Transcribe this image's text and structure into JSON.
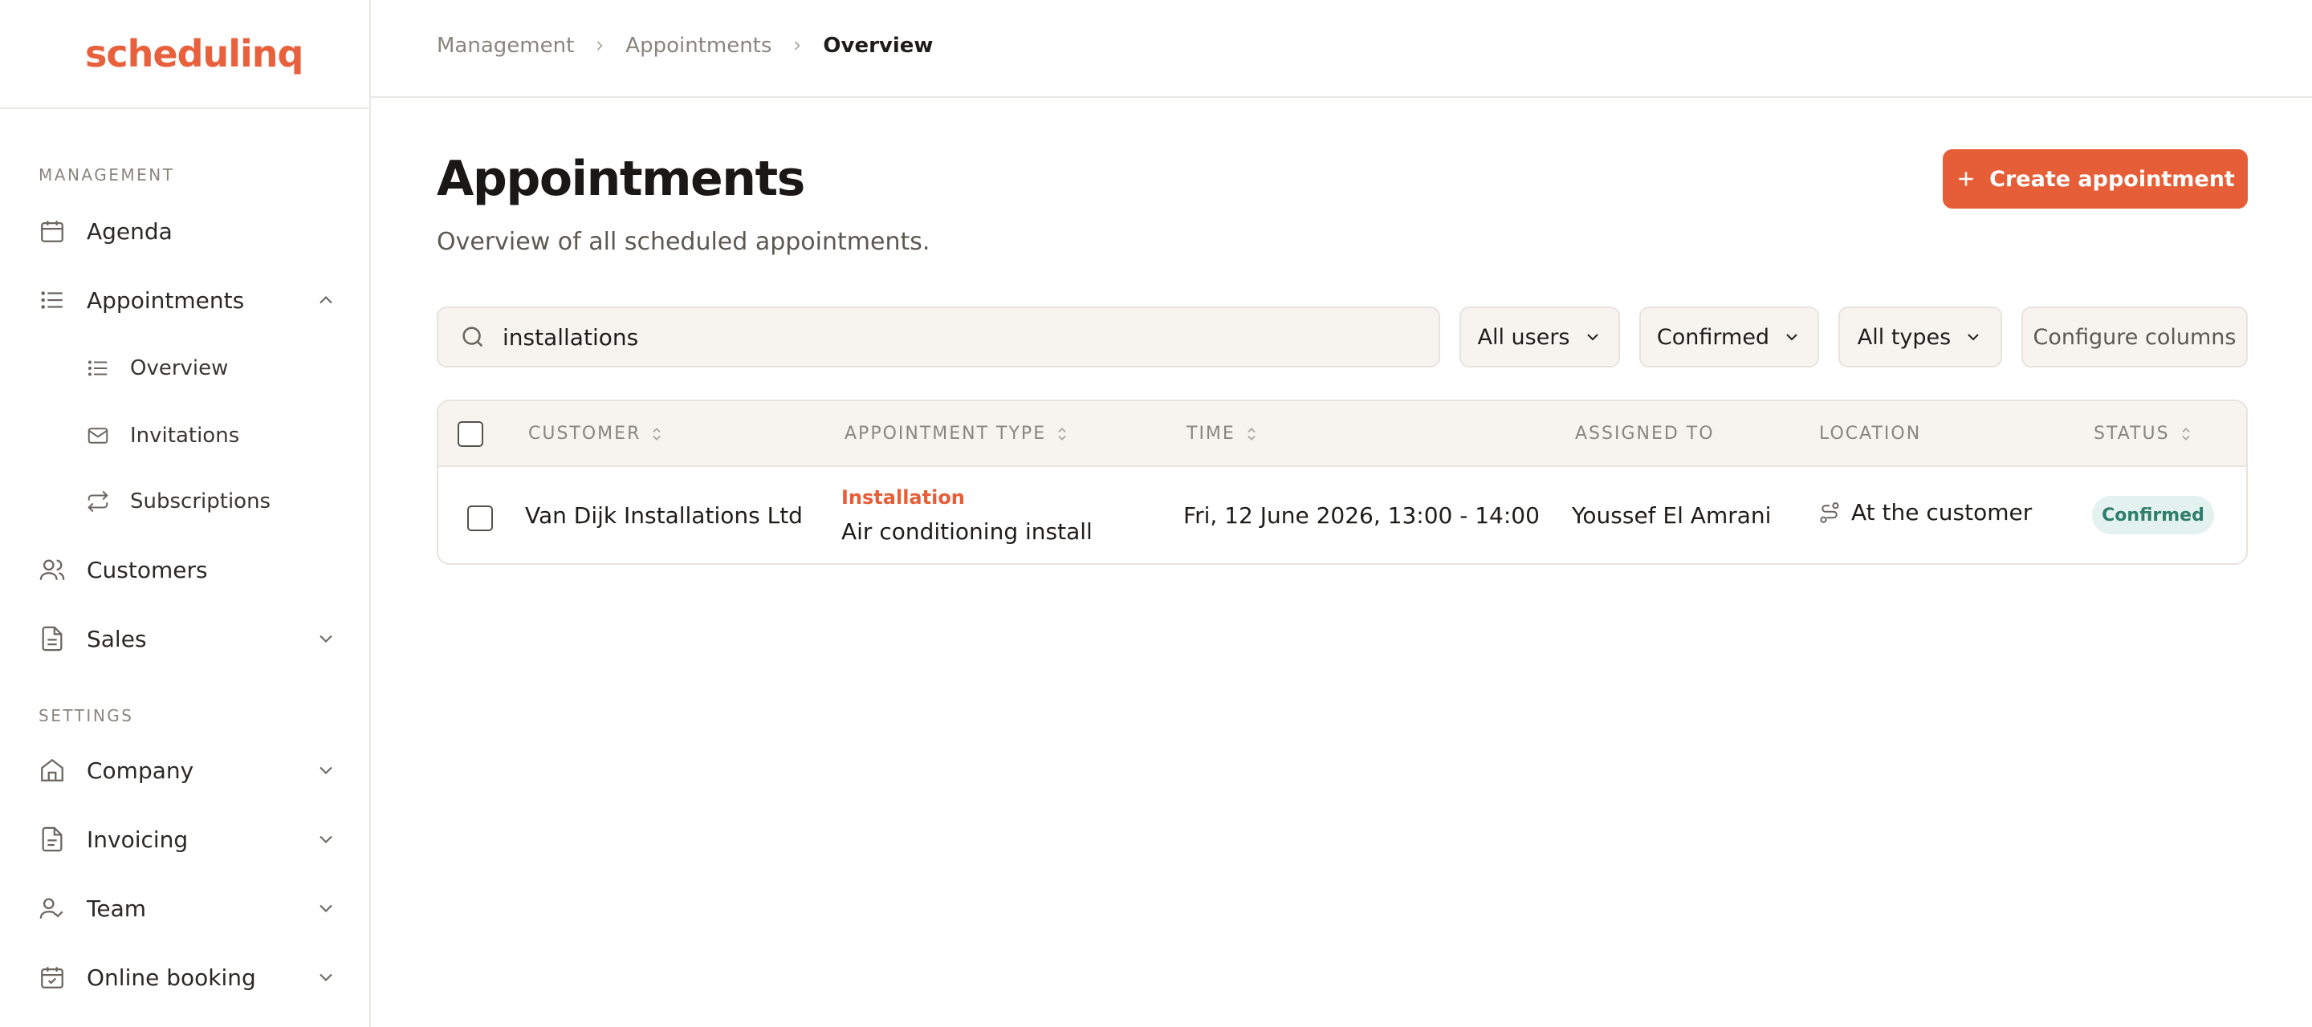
{
  "app": {
    "logo_text": "schedulinq",
    "brand_color": "#e8603c"
  },
  "sidebar": {
    "sections": [
      {
        "title": "MANAGEMENT"
      },
      {
        "title": "SETTINGS"
      }
    ],
    "items": [
      {
        "label": "Agenda",
        "icon": "calendar-icon"
      },
      {
        "label": "Appointments",
        "icon": "list-icon",
        "expanded": true
      },
      {
        "label": "Customers",
        "icon": "users-icon"
      },
      {
        "label": "Sales",
        "icon": "document-icon"
      },
      {
        "label": "Company",
        "icon": "building-icon"
      },
      {
        "label": "Invoicing",
        "icon": "invoice-icon"
      },
      {
        "label": "Team",
        "icon": "team-icon"
      },
      {
        "label": "Online booking",
        "icon": "calendar-check-icon"
      }
    ],
    "subitems": [
      {
        "label": "Overview",
        "icon": "list-icon"
      },
      {
        "label": "Invitations",
        "icon": "mail-icon"
      },
      {
        "label": "Subscriptions",
        "icon": "repeat-icon"
      }
    ]
  },
  "breadcrumb": [
    "Management",
    "Appointments",
    "Overview"
  ],
  "page": {
    "title": "Appointments",
    "subtitle": "Overview of all scheduled appointments.",
    "create_button": "Create appointment"
  },
  "filters": {
    "search_value": "installations",
    "users": "All users",
    "status": "Confirmed",
    "types": "All types",
    "configure": "Configure columns"
  },
  "table": {
    "columns": [
      "CUSTOMER",
      "APPOINTMENT TYPE",
      "TIME",
      "ASSIGNED TO",
      "LOCATION",
      "STATUS"
    ],
    "rows": [
      {
        "customer": "Van Dijk Installations Ltd",
        "type_category": "Installation",
        "type_name": "Air conditioning install",
        "time": "Fri, 12 June 2026, 13:00 - 14:00",
        "assigned_to": "Youssef El Amrani",
        "location": "At the customer",
        "status": "Confirmed"
      }
    ]
  }
}
